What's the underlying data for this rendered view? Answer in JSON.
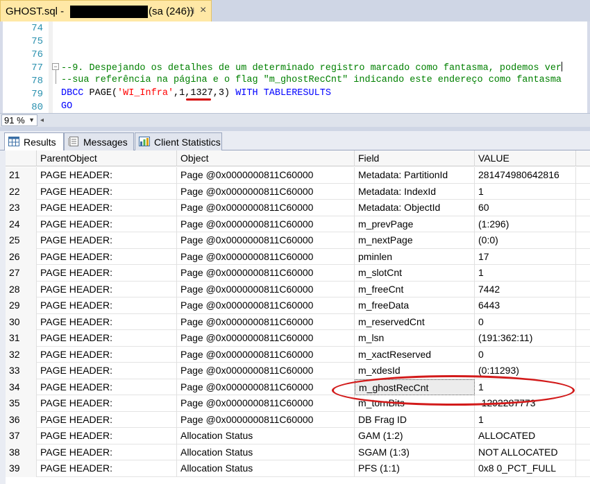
{
  "tab": {
    "title": "GHOST.sql - ",
    "login": "(sa (246))",
    "pin": "⊣",
    "close": "×"
  },
  "editor": {
    "lines": [
      {
        "num": "74"
      },
      {
        "num": "75"
      },
      {
        "num": "76"
      },
      {
        "num": "77",
        "text": "--9. Despejando os detalhes de um determinado registro marcado como fantasma, podemos ver"
      },
      {
        "num": "78",
        "text": "--sua referência na página e o flag \"m_ghostRecCnt\" indicando este endereço como fantasma"
      },
      {
        "num": "79",
        "kw1": "DBCC",
        "fn": "PAGE",
        "str": "'WI_Infra'",
        "args_a": ",1,",
        "args_b": "1327",
        "args_c": ",3)",
        "kw2": "WITH",
        "kw3": "TABLERESULTS"
      },
      {
        "num": "80",
        "kw1": "GO"
      }
    ]
  },
  "zoom": {
    "value": "91 %"
  },
  "result_tabs": [
    {
      "label": "Results",
      "icon": "grid-icon",
      "active": true
    },
    {
      "label": "Messages",
      "icon": "messages-icon",
      "active": false
    },
    {
      "label": "Client Statistics",
      "icon": "statistics-icon",
      "active": false
    }
  ],
  "grid": {
    "columns": [
      "",
      "ParentObject",
      "Object",
      "Field",
      "VALUE"
    ],
    "rows": [
      [
        "21",
        "PAGE HEADER:",
        "Page @0x0000000811C60000",
        "Metadata: PartitionId",
        "281474980642816"
      ],
      [
        "22",
        "PAGE HEADER:",
        "Page @0x0000000811C60000",
        "Metadata: IndexId",
        "1"
      ],
      [
        "23",
        "PAGE HEADER:",
        "Page @0x0000000811C60000",
        "Metadata: ObjectId",
        "60"
      ],
      [
        "24",
        "PAGE HEADER:",
        "Page @0x0000000811C60000",
        "m_prevPage",
        "(1:296)"
      ],
      [
        "25",
        "PAGE HEADER:",
        "Page @0x0000000811C60000",
        "m_nextPage",
        "(0:0)"
      ],
      [
        "26",
        "PAGE HEADER:",
        "Page @0x0000000811C60000",
        "pminlen",
        "17"
      ],
      [
        "27",
        "PAGE HEADER:",
        "Page @0x0000000811C60000",
        "m_slotCnt",
        "1"
      ],
      [
        "28",
        "PAGE HEADER:",
        "Page @0x0000000811C60000",
        "m_freeCnt",
        "7442"
      ],
      [
        "29",
        "PAGE HEADER:",
        "Page @0x0000000811C60000",
        "m_freeData",
        "6443"
      ],
      [
        "30",
        "PAGE HEADER:",
        "Page @0x0000000811C60000",
        "m_reservedCnt",
        "0"
      ],
      [
        "31",
        "PAGE HEADER:",
        "Page @0x0000000811C60000",
        "m_lsn",
        "(191:362:11)"
      ],
      [
        "32",
        "PAGE HEADER:",
        "Page @0x0000000811C60000",
        "m_xactReserved",
        "0"
      ],
      [
        "33",
        "PAGE HEADER:",
        "Page @0x0000000811C60000",
        "m_xdesId",
        "(0:11293)"
      ],
      [
        "34",
        "PAGE HEADER:",
        "Page @0x0000000811C60000",
        "m_ghostRecCnt",
        "1"
      ],
      [
        "35",
        "PAGE HEADER:",
        "Page @0x0000000811C60000",
        "m_tornBits",
        "-1292287773"
      ],
      [
        "36",
        "PAGE HEADER:",
        "Page @0x0000000811C60000",
        "DB Frag ID",
        "1"
      ],
      [
        "37",
        "PAGE HEADER:",
        "Allocation Status",
        "GAM (1:2)",
        "ALLOCATED"
      ],
      [
        "38",
        "PAGE HEADER:",
        "Allocation Status",
        "SGAM (1:3)",
        "NOT ALLOCATED"
      ],
      [
        "39",
        "PAGE HEADER:",
        "Allocation Status",
        "PFS (1:1)",
        "0x8  0_PCT_FULL"
      ]
    ],
    "highlighted_row_index": 13
  },
  "colors": {
    "tab_bg": "#ffe8a6",
    "comment": "#008000",
    "keyword": "#0000ff",
    "string": "#ff0000",
    "annotation": "#d21a1a"
  }
}
